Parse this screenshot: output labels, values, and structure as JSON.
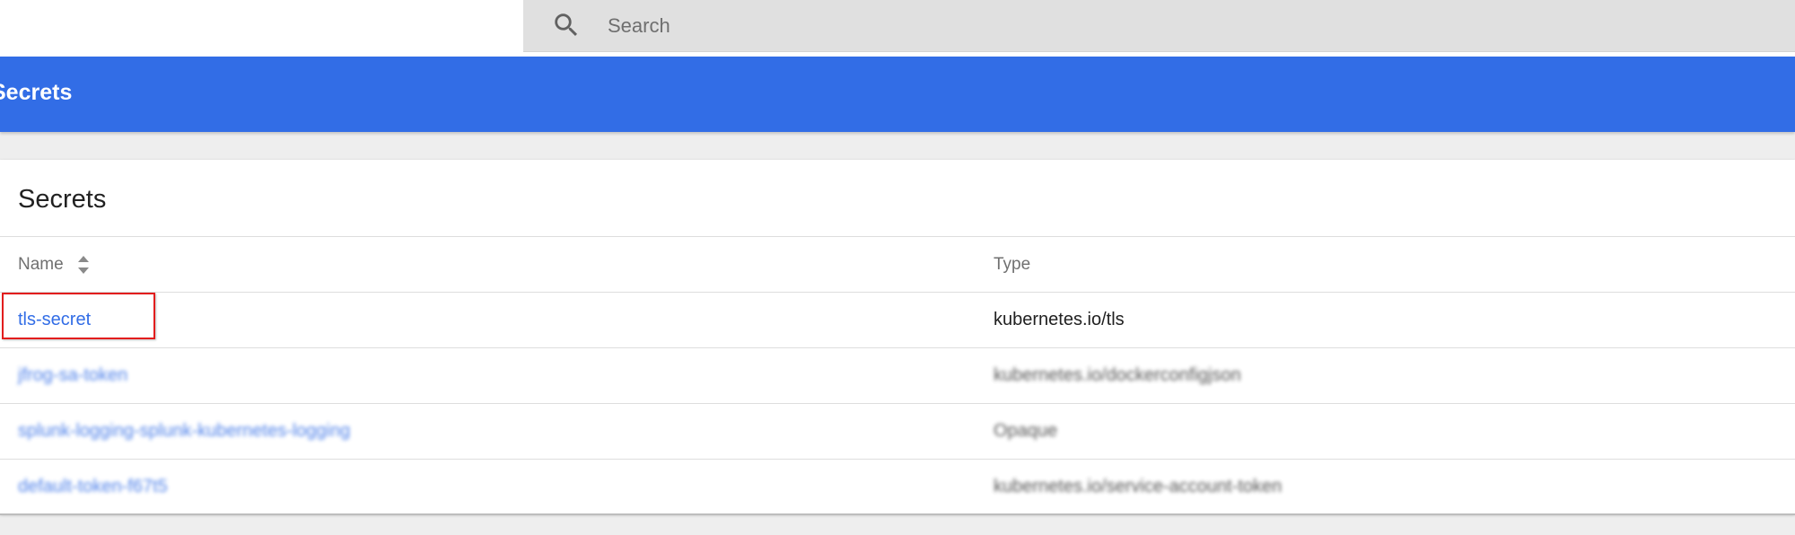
{
  "search": {
    "placeholder": "Search",
    "icon": "search-icon"
  },
  "header": {
    "title": "Secrets"
  },
  "card": {
    "title": "Secrets",
    "columns": {
      "name": "Name",
      "type": "Type"
    },
    "rows": [
      {
        "name": "tls-secret",
        "type": "kubernetes.io/tls"
      },
      {
        "name": "jfrog-sa-token",
        "type": "kubernetes.io/dockerconfigjson"
      },
      {
        "name": "splunk-logging-splunk-kubernetes-logging",
        "type": "Opaque"
      },
      {
        "name": "default-token-f67t5",
        "type": "kubernetes.io/service-account-token"
      }
    ]
  },
  "colors": {
    "brand_blue": "#326de6",
    "highlight_red": "#e21d1d"
  }
}
